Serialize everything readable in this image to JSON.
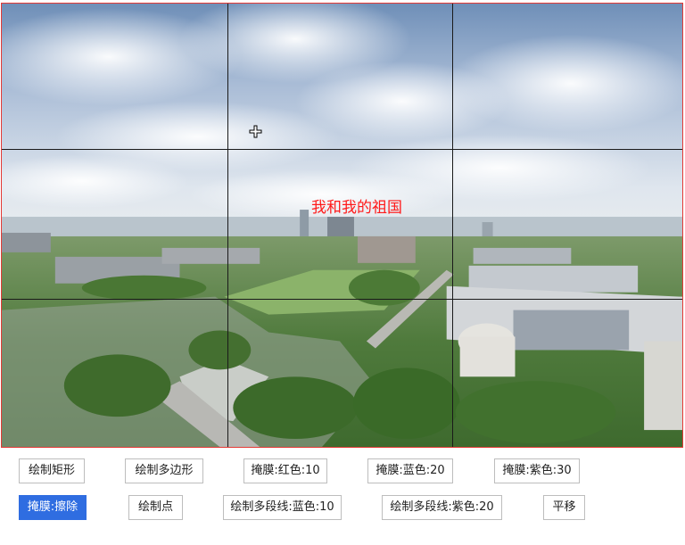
{
  "canvas": {
    "overlay_text": "我和我的祖国",
    "overlay_text_color": "#ff1a1a",
    "border_color": "#e53935",
    "grid_color": "#1a1a1a"
  },
  "toolbar": {
    "active_color": "#2f6de1",
    "row1": {
      "draw_rect": "绘制矩形",
      "draw_polygon": "绘制多边形",
      "mask_red": "掩膜:红色:10",
      "mask_blue": "掩膜:蓝色:20",
      "mask_purple": "掩膜:紫色:30"
    },
    "row2": {
      "mask_erase": "掩膜:擦除",
      "draw_point": "绘制点",
      "polyline_blue": "绘制多段线:蓝色:10",
      "polyline_purple": "绘制多段线:紫色:20",
      "pan": "平移"
    }
  }
}
